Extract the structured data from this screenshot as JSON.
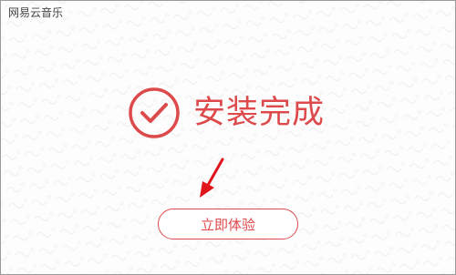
{
  "window": {
    "title": "网易云音乐"
  },
  "install": {
    "status_text": "安装完成",
    "status_icon": "check-circle-icon",
    "button_label": "立即体验"
  },
  "colors": {
    "accent": "#dd4a4c",
    "arrow": "#e0141c",
    "background": "#fdfdfd"
  }
}
